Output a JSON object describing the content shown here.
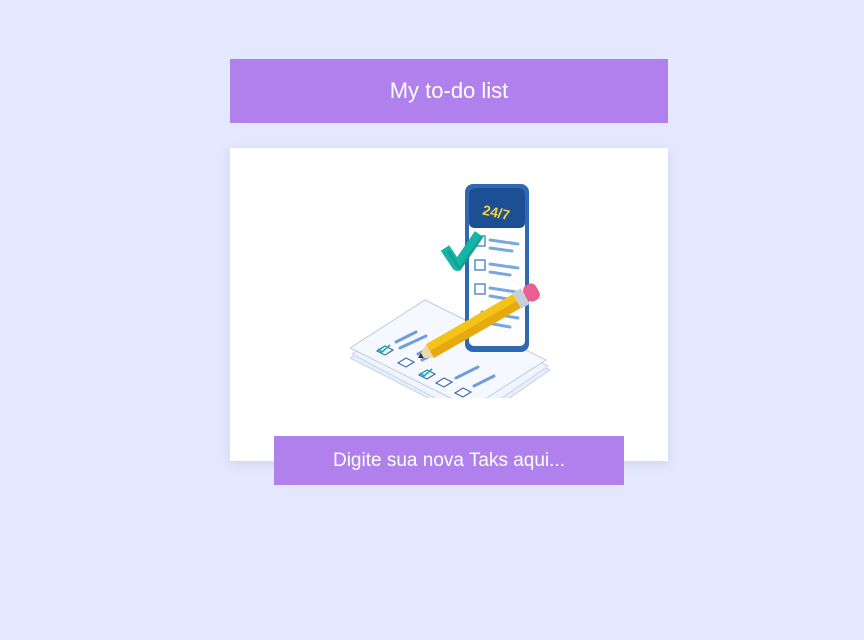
{
  "header": {
    "title": "My to-do list"
  },
  "hero": {
    "image": "todo-checklist-illustration",
    "phone_screen_text": "24/7"
  },
  "task_input": {
    "placeholder": "Digite sua nova Taks aqui..."
  },
  "colors": {
    "background": "#e3e8fe",
    "accent": "#b080ec",
    "card": "#ffffff"
  }
}
